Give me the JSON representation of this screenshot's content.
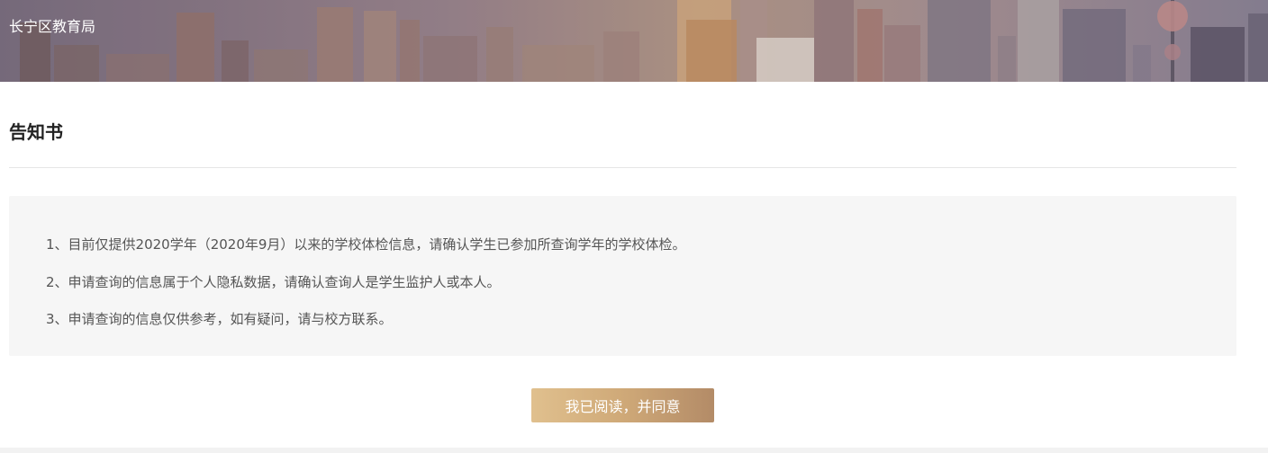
{
  "header": {
    "title": "长宁区教育局"
  },
  "notice": {
    "title": "告知书",
    "items": [
      "1、目前仅提供2020学年（2020年9月）以来的学校体检信息，请确认学生已参加所查询学年的学校体检。",
      "2、申请查询的信息属于个人隐私数据，请确认查询人是学生监护人或本人。",
      "3、申请查询的信息仅供参考，如有疑问，请与校方联系。"
    ]
  },
  "actions": {
    "agree_label": "我已阅读，并同意"
  },
  "colors": {
    "button_gradient_start": "#e0c08e",
    "button_gradient_end": "#b38b67",
    "notice_background": "#f6f6f6"
  }
}
